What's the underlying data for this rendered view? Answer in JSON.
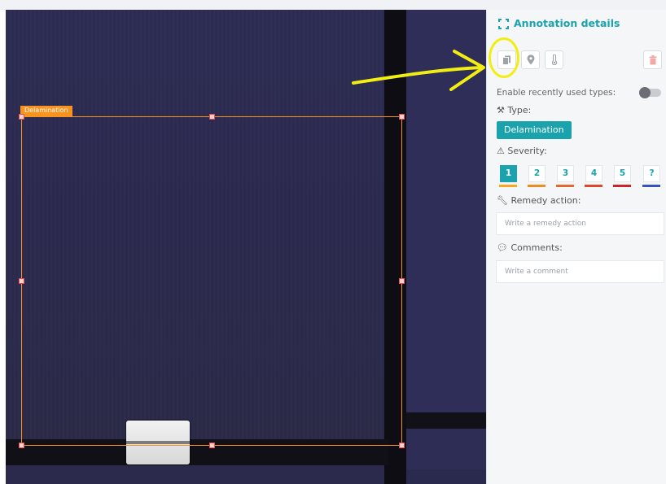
{
  "image_panel": {
    "annotation_label": "Delamination",
    "box_color": "#f7931e"
  },
  "sidebar": {
    "title": "Annotation details",
    "accent": "#1aa3ad",
    "tools": {
      "copy_icon": "copy-icon",
      "location_icon": "map-pin-icon",
      "temperature_icon": "thermometer-icon",
      "delete_icon": "trash-icon"
    },
    "recent_types_label": "Enable recently used types:",
    "recent_types_enabled": false,
    "type_label": "Type:",
    "type_value": "Delamination",
    "severity_label": "Severity:",
    "severity_options": [
      "1",
      "2",
      "3",
      "4",
      "5",
      "?"
    ],
    "severity_selected": "1",
    "severity_colors": [
      "#f5a623",
      "#f08a24",
      "#e8662f",
      "#e0452f",
      "#c8262b",
      "#3b4fc4"
    ],
    "remedy_label": "Remedy action:",
    "remedy_placeholder": "Write a remedy action",
    "comments_label": "Comments:",
    "comments_placeholder": "Write a comment"
  },
  "highlight": {
    "color": "#f2ee12"
  }
}
